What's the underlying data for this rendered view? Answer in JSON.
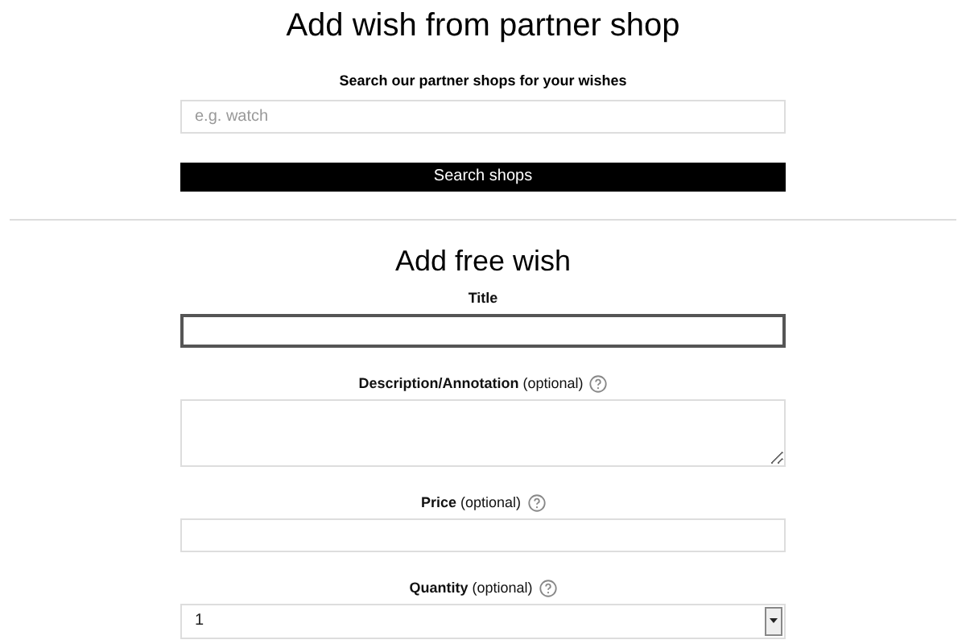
{
  "partner_section": {
    "heading": "Add wish from partner shop",
    "search_label": "Search our partner shops for your wishes",
    "search": {
      "placeholder": "e.g. watch"
    },
    "button": "Search shops"
  },
  "free_section": {
    "heading": "Add free wish",
    "fields": [
      {
        "kind": "text",
        "name": "Title",
        "focused": true,
        "help": false
      },
      {
        "kind": "textarea",
        "name": "Description/Annotation",
        "note": "(optional)",
        "focused": false,
        "help": true
      },
      {
        "kind": "text",
        "name": "Price",
        "note": "(optional)",
        "focused": false,
        "help": true
      },
      {
        "kind": "select",
        "name": "Quantity",
        "note": "(optional)",
        "value": "1",
        "focused": false,
        "help": true
      }
    ]
  }
}
